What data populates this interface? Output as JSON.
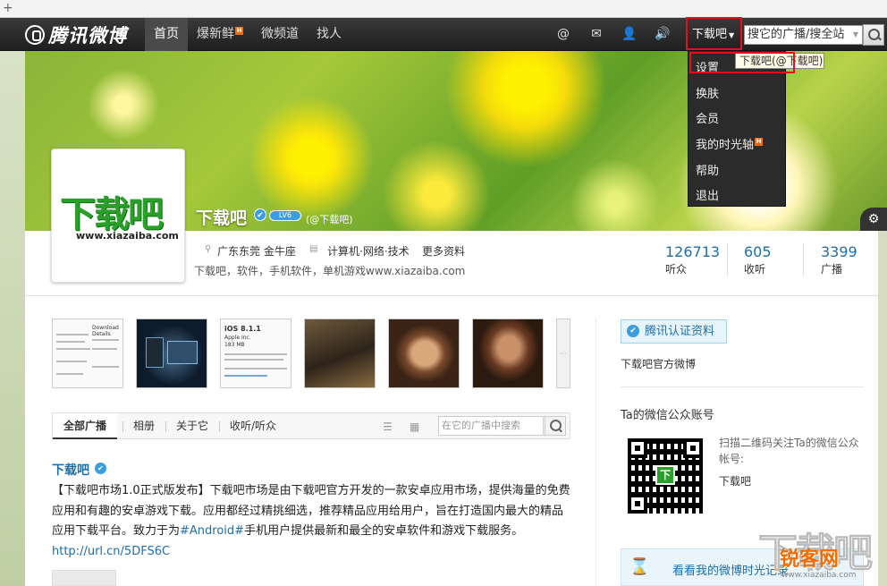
{
  "app": {
    "logo_text": "腾讯微博"
  },
  "nav": {
    "items": [
      {
        "label": "首页",
        "active": true
      },
      {
        "label": "爆新鲜",
        "badge": "H"
      },
      {
        "label": "微频道"
      },
      {
        "label": "找人"
      }
    ]
  },
  "topbar": {
    "icons": [
      "at-icon",
      "mail-icon",
      "user-icon",
      "speaker-icon"
    ],
    "download_menu_label": "下载吧",
    "search_value": "搜它的广播/搜全站"
  },
  "dropdown": {
    "items": [
      {
        "label": "设置"
      },
      {
        "label": "换肤"
      },
      {
        "label": "会员"
      },
      {
        "label": "我的时光轴",
        "badge": "H"
      },
      {
        "label": "帮助"
      },
      {
        "label": "退出"
      }
    ],
    "tooltip": "下载吧(@下载吧)"
  },
  "profile": {
    "name": "下载吧",
    "level": "LV6",
    "handle": "(@下载吧)",
    "avatar_logo": "下载吧",
    "avatar_url": "www.xiazaiba.com",
    "location": "广东东莞 金牛座",
    "job": "计算机·网络·技术",
    "more_info": "更多资料",
    "bio": "下载吧，软件，手机软件，单机游戏www.xiazaiba.com",
    "stats": [
      {
        "value": "126713",
        "label": "听众"
      },
      {
        "value": "605",
        "label": "收听"
      },
      {
        "value": "3399",
        "label": "广播"
      }
    ]
  },
  "thumbnails": {
    "doc1_title": "Download Details",
    "doc2_title": "iOS 8.1.1",
    "doc2_line1": "Apple Inc.",
    "doc2_line2": "183 MB"
  },
  "tabs": {
    "items": [
      {
        "label": "全部广播",
        "active": true
      },
      {
        "label": "相册"
      },
      {
        "label": "关于它"
      },
      {
        "label": "收听/听众"
      }
    ],
    "search_placeholder": "在它的广播中搜索"
  },
  "post": {
    "author": "下载吧",
    "body_text": "【下载吧市场1.0正式版发布】下载吧市场是由下载吧官方开发的一款安卓应用市场，提供海量的免费应用和有趣的安卓游戏下载。应用都经过精挑细选，推荐精品应用给用户，旨在打造国内最大的精品应用下载平台。致力于为",
    "hashtag": "#Android#",
    "body_text2": "手机用户提供最新和最全的安卓软件和游戏下载服务。",
    "link": "http://url.cn/5DFS6C"
  },
  "sidebar": {
    "cert_label": "腾讯认证资料",
    "official_text": "下载吧官方微博",
    "wechat_title": "Ta的微信公众账号",
    "wechat_desc": "扫描二维码关注Ta的微信公众帐号:",
    "wechat_name": "下载吧",
    "timeline_label": "看看我的微博时光记录"
  },
  "watermark": {
    "big": "下载吧",
    "small": "锐客网",
    "url": "www.xiazaiba.com"
  }
}
